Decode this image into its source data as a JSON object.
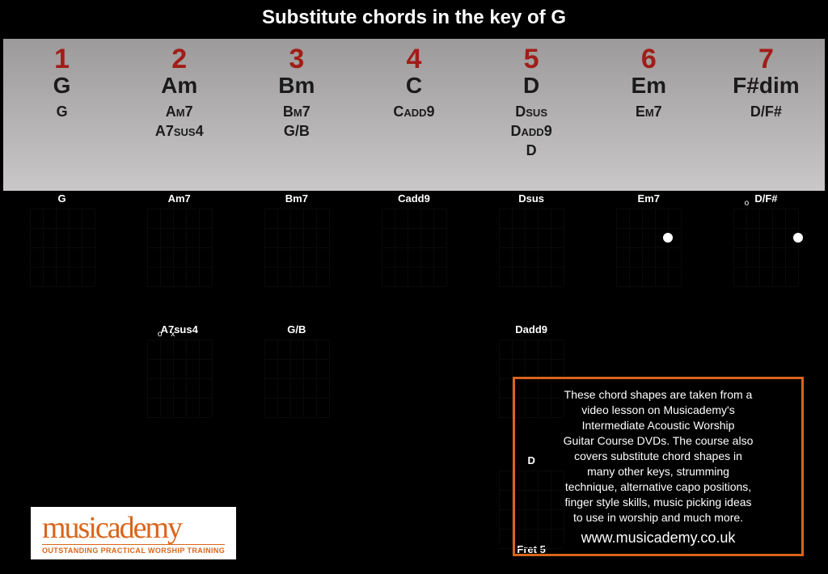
{
  "title": "Substitute chords in the key of G",
  "degrees": [
    {
      "num": "1",
      "chord": "G",
      "subs": [
        "G"
      ]
    },
    {
      "num": "2",
      "chord": "Am",
      "subs": [
        "Am7",
        "A7sus4"
      ]
    },
    {
      "num": "3",
      "chord": "Bm",
      "subs": [
        "Bm7",
        "G/B"
      ]
    },
    {
      "num": "4",
      "chord": "C",
      "subs": [
        "Cadd9"
      ]
    },
    {
      "num": "5",
      "chord": "D",
      "subs": [
        "Dsus",
        "Dadd9",
        "D"
      ]
    },
    {
      "num": "6",
      "chord": "Em",
      "subs": [
        "Em7"
      ]
    },
    {
      "num": "7",
      "chord": "F#dim",
      "subs": [
        "D/F#"
      ]
    }
  ],
  "diagrams_row1": [
    {
      "label": "G"
    },
    {
      "label": "Am7"
    },
    {
      "label": "Bm7"
    },
    {
      "label": "Cadd9"
    },
    {
      "label": "Dsus"
    },
    {
      "label": "Em7",
      "dots": [
        [
          4,
          2
        ]
      ]
    },
    {
      "label": "D/F#",
      "open": [
        "",
        "o",
        "",
        "",
        "",
        ""
      ],
      "dots": [
        [
          5,
          2
        ]
      ]
    }
  ],
  "diagrams_row2": [
    {
      "label": ""
    },
    {
      "label": "A7sus4",
      "open": [
        "",
        "o",
        "x",
        "",
        "",
        ""
      ]
    },
    {
      "label": "G/B"
    },
    {
      "label": ""
    },
    {
      "label": "Dadd9"
    },
    {
      "label": ""
    },
    {
      "label": ""
    }
  ],
  "diagrams_row3": [
    {
      "label": ""
    },
    {
      "label": ""
    },
    {
      "label": ""
    },
    {
      "label": ""
    },
    {
      "label": "D",
      "sublabel": "Fret 5"
    },
    {
      "label": ""
    },
    {
      "label": ""
    }
  ],
  "info_lines": [
    "These chord shapes are taken from a",
    "video lesson on Musicademy's",
    "Intermediate Acoustic Worship",
    "Guitar Course DVDs. The course also",
    "covers substitute chord shapes in",
    "many other keys, strumming",
    "technique, alternative capo positions,",
    "finger style skills, music picking ideas",
    "to use in worship and much more."
  ],
  "info_url": "www.musicademy.co.uk",
  "logo_brand": "musicademy",
  "logo_tag": "OUTSTANDING PRACTICAL WORSHIP TRAINING"
}
